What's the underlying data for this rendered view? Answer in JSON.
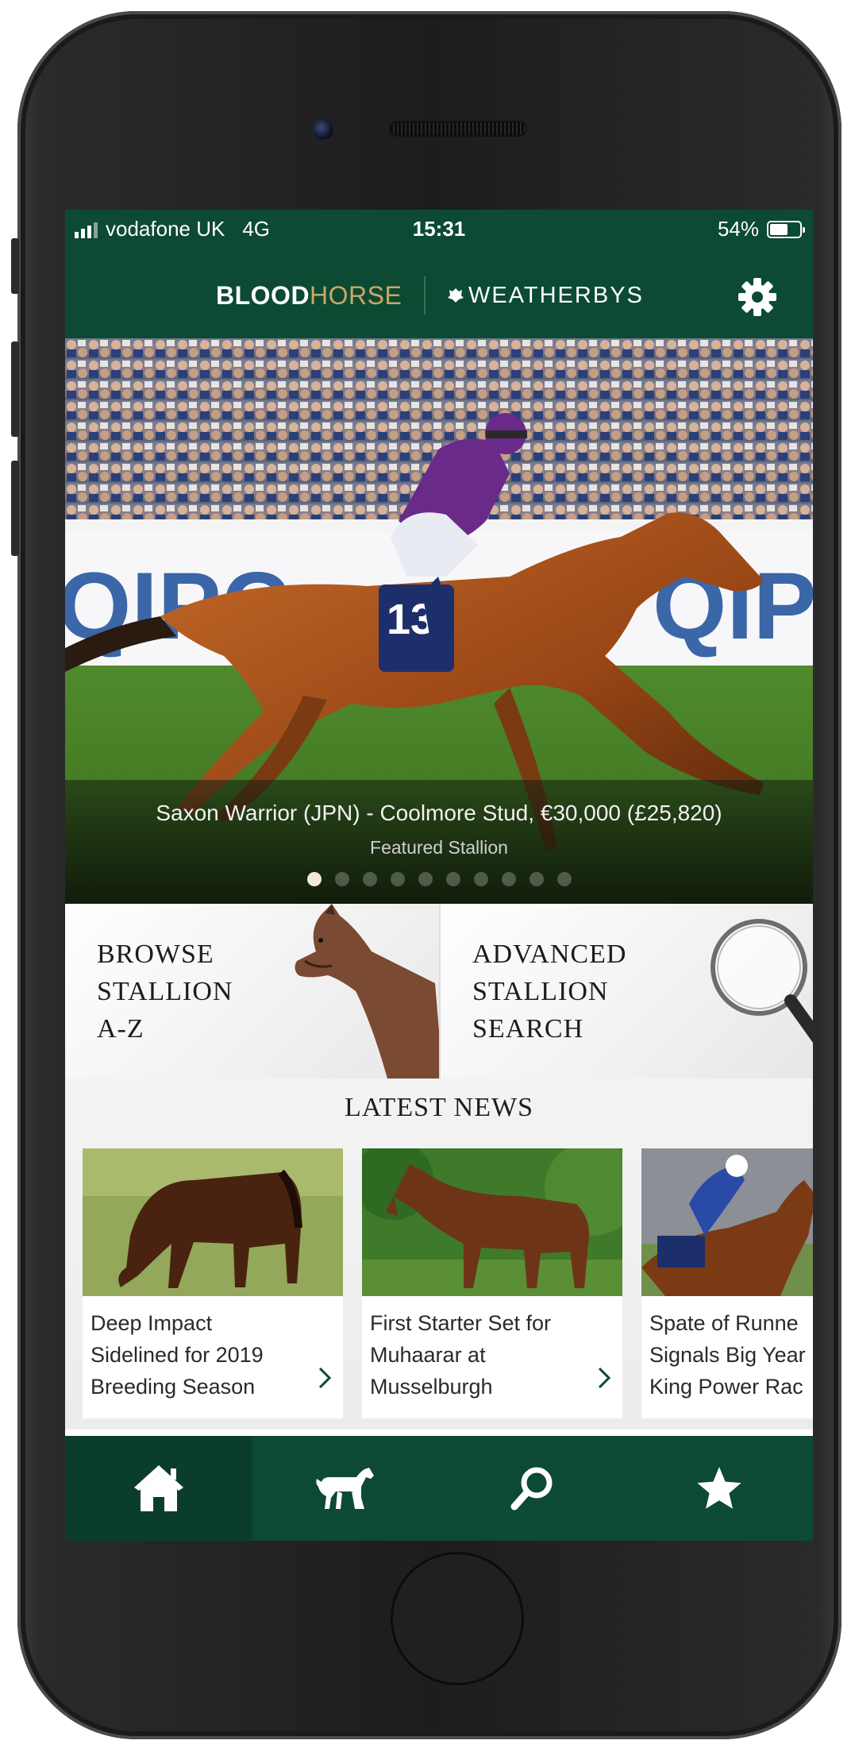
{
  "status_bar": {
    "carrier": "vodafone UK",
    "network": "4G",
    "time": "15:31",
    "battery": "54%",
    "battery_level": 0.54
  },
  "header": {
    "logo_primary_bold": "BLOOD",
    "logo_primary_light": "HORSE",
    "logo_secondary": "WEATHERBYS",
    "icons": [
      "settings-icon"
    ]
  },
  "featured": {
    "caption": "Saxon Warrior (JPN) - Coolmore Stud, €30,000 (£25,820)",
    "subtitle": "Featured Stallion",
    "saddle_number": "13",
    "slide_count": 10,
    "active_slide": 1
  },
  "tiles": [
    {
      "line1": "BROWSE",
      "line2": "STALLION",
      "line3": "A-Z"
    },
    {
      "line1": "ADVANCED",
      "line2": "STALLION",
      "line3": "SEARCH"
    }
  ],
  "news": {
    "title": "LATEST NEWS",
    "items": [
      {
        "line1": "Deep Impact",
        "line2": "Sidelined for 2019",
        "line3": "Breeding Season"
      },
      {
        "line1": "First Starter Set for",
        "line2": "Muhaarar at",
        "line3": "Musselburgh"
      },
      {
        "line1": "Spate of Runne",
        "line2": "Signals Big Year",
        "line3": "King Power Rac"
      }
    ]
  },
  "tabbar": {
    "tabs": [
      "home-icon",
      "horse-icon",
      "search-icon",
      "star-icon"
    ],
    "active": "home-icon"
  },
  "colors": {
    "brand_green": "#0c4a33",
    "gold": "#c9a866"
  }
}
